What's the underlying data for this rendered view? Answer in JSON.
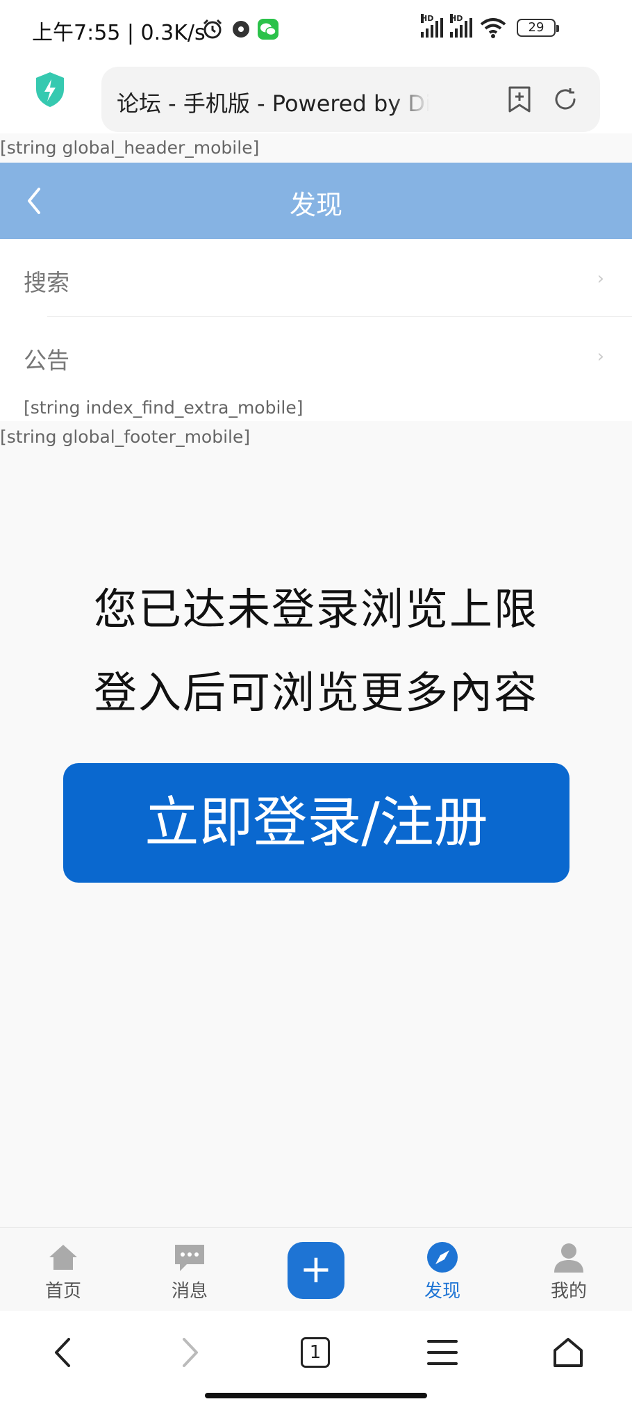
{
  "status_bar": {
    "text": "上午7:55 | 0.3K/s",
    "battery": "29"
  },
  "browser": {
    "url": "论坛 - 手机版 - Powered by Discuz!"
  },
  "strings": {
    "header": "[string global_header_mobile]",
    "extra": "[string index_find_extra_mobile]",
    "footer": "[string global_footer_mobile]"
  },
  "header": {
    "title": "发现"
  },
  "list": [
    {
      "label": "搜索"
    },
    {
      "label": "公告"
    }
  ],
  "notice": {
    "line1": "您已达未登录浏览上限",
    "line2": "登入后可浏览更多內容",
    "button": "立即登录/注册"
  },
  "tabs": [
    {
      "label": "首页",
      "icon": "home-icon"
    },
    {
      "label": "消息",
      "icon": "message-icon"
    },
    {
      "label": "+",
      "icon": "plus-icon"
    },
    {
      "label": "发现",
      "icon": "compass-icon",
      "active": true
    },
    {
      "label": "我的",
      "icon": "user-icon"
    }
  ],
  "system_nav": {
    "tab_count": "1"
  },
  "colors": {
    "accent": "#1e74d4",
    "header_bg": "#86b3e3",
    "button_bg": "#0a68cf"
  }
}
